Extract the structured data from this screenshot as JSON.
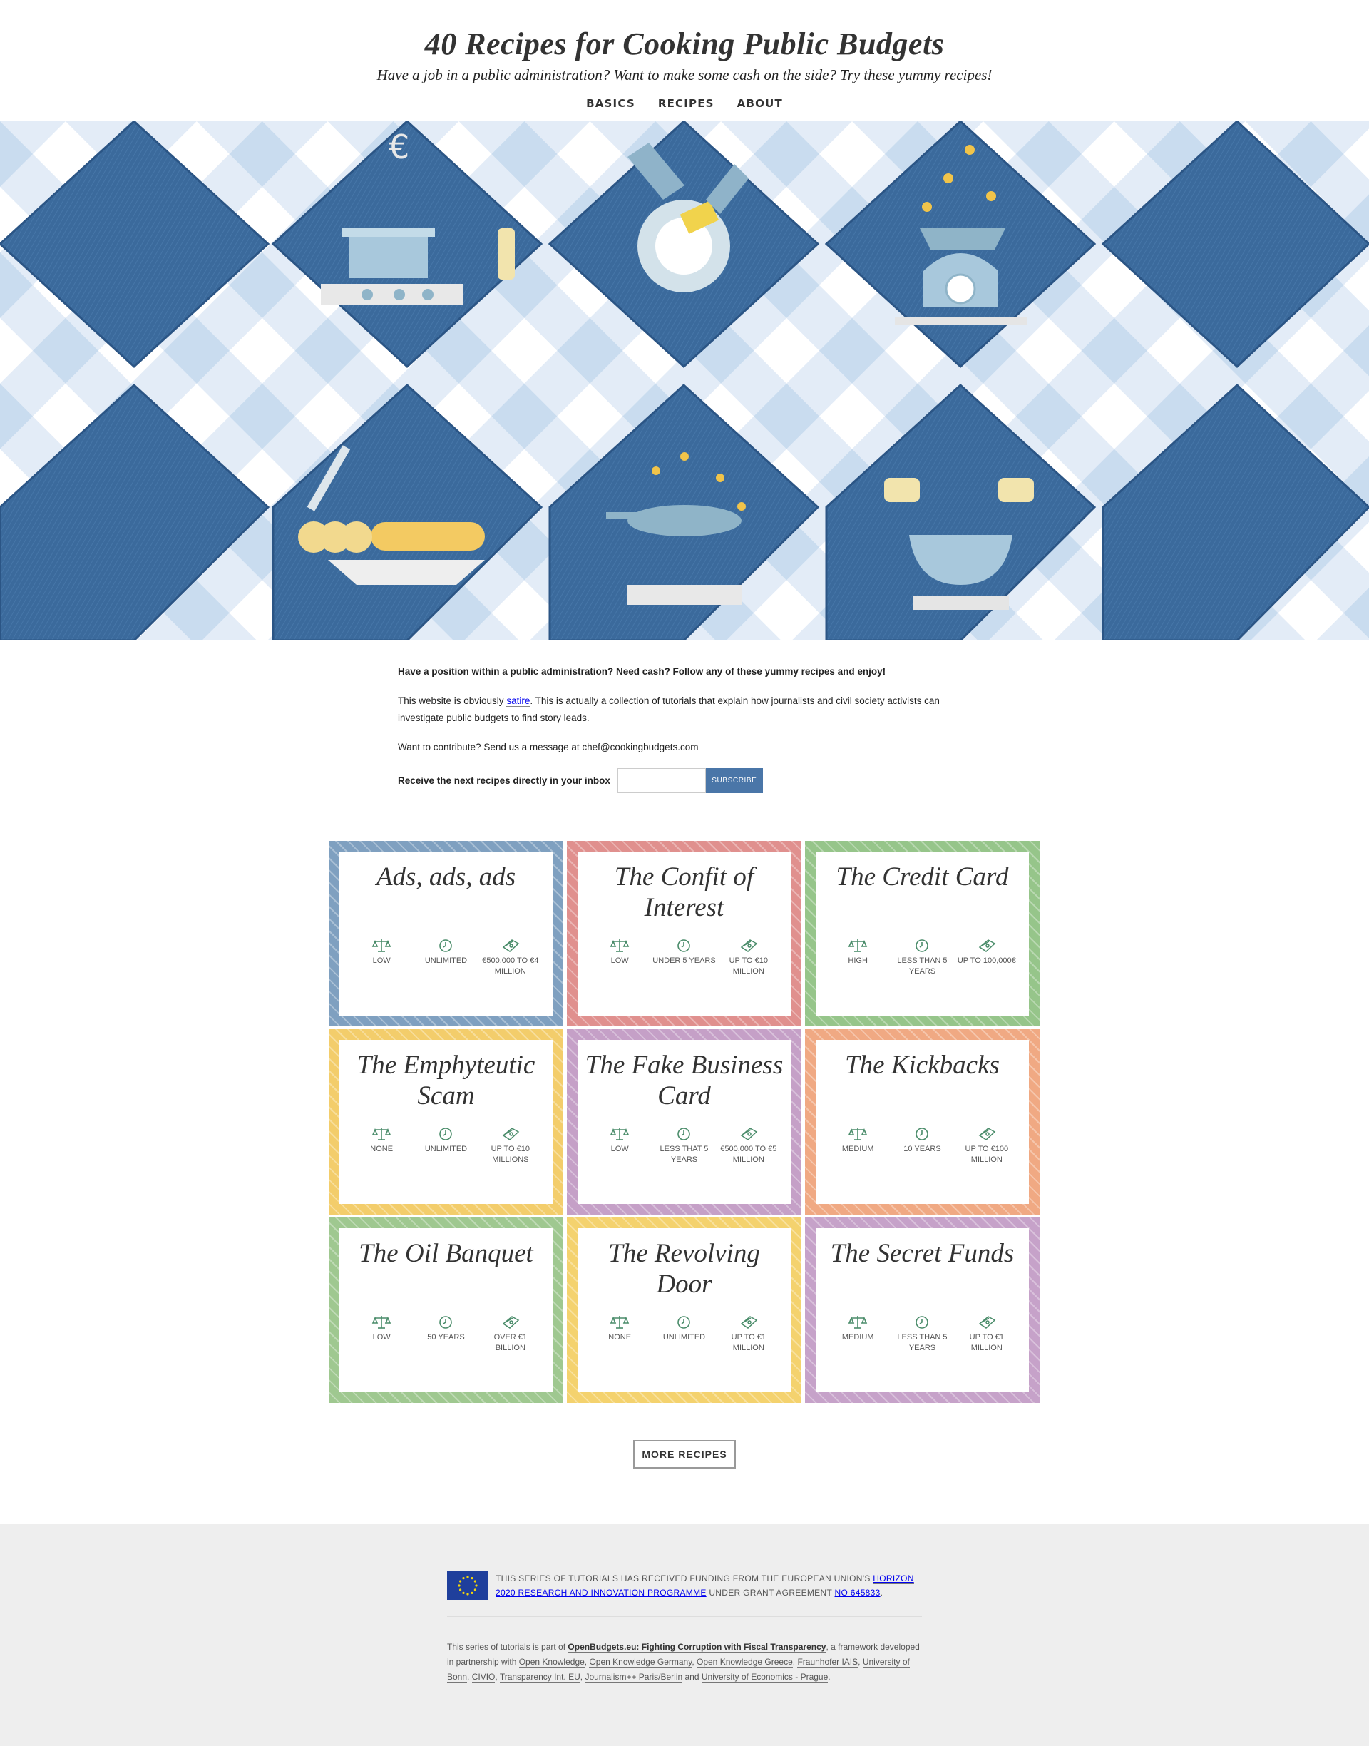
{
  "header": {
    "title": "40 Recipes for Cooking Public Budgets",
    "subtitle": "Have a job in a public administration? Want to make some cash on the side? Try these yummy recipes!",
    "nav": [
      "BASICS",
      "RECIPES",
      "ABOUT"
    ]
  },
  "colors": {
    "tile_blue": "#3b6a9c",
    "check_light": "#c9dcef",
    "accent_button": "#4a76a8"
  },
  "intro": {
    "lead": "Have a position within a public administration? Need cash? Follow any of these yummy recipes and enjoy!",
    "p2_before": "This website is obviously ",
    "p2_link": "satire",
    "p2_after": ". This is actually a collection of tutorials that explain how journalists and civil society activists can investigate public budgets to find story leads.",
    "p3": "Want to contribute? Send us a message at chef@cookingbudgets.com",
    "subscribe_label": "Receive the next recipes directly in your inbox",
    "subscribe_button": "SUBSCRIBE"
  },
  "cards": [
    {
      "title": "Ads, ads, ads",
      "color": "#7fa0c0",
      "risk": "LOW",
      "time": "UNLIMITED",
      "money": "€500,000 TO €4 MILLION"
    },
    {
      "title": "The Confit of Interest",
      "color": "#e0908e",
      "risk": "LOW",
      "time": "UNDER 5 YEARS",
      "money": "UP TO €10 MILLION"
    },
    {
      "title": "The Credit Card",
      "color": "#96c58a",
      "risk": "HIGH",
      "time": "LESS THAN 5 YEARS",
      "money": "UP TO 100,000€"
    },
    {
      "title": "The Emphyteutic Scam",
      "color": "#f3cd6b",
      "risk": "NONE",
      "time": "UNLIMITED",
      "money": "UP TO €10 MILLIONS"
    },
    {
      "title": "The Fake Business Card",
      "color": "#c5a0c7",
      "risk": "LOW",
      "time": "LESS THAT 5 YEARS",
      "money": "€500,000 TO €5 MILLION"
    },
    {
      "title": "The Kickbacks",
      "color": "#f0a983",
      "risk": "MEDIUM",
      "time": "10 YEARS",
      "money": "UP TO €100 MILLION"
    },
    {
      "title": "The Oil Banquet",
      "color": "#9fc890",
      "risk": "LOW",
      "time": "50 YEARS",
      "money": "OVER €1 BILLION"
    },
    {
      "title": "The Revolving Door",
      "color": "#f4d26e",
      "risk": "NONE",
      "time": "UNLIMITED",
      "money": "UP TO €1 MILLION"
    },
    {
      "title": "The Secret Funds",
      "color": "#c6a2c9",
      "risk": "MEDIUM",
      "time": "LESS THAN 5 YEARS",
      "money": "UP TO €1 MILLION"
    }
  ],
  "more_button": "MORE RECIPES",
  "footer": {
    "eu_before": "THIS SERIES OF TUTORIALS HAS RECEIVED FUNDING FROM THE EUROPEAN UNION'S ",
    "eu_link1": "HORIZON 2020 RESEARCH AND INNOVATION PROGRAMME",
    "eu_mid": " UNDER GRANT AGREEMENT ",
    "eu_link2": "NO 645833",
    "eu_end": ".",
    "credits_before": "This series of tutorials is part of ",
    "credits_bold": "OpenBudgets.eu: Fighting Corruption with Fiscal Transparency",
    "credits_mid": ", a framework developed in partnership with ",
    "partners": [
      "Open Knowledge",
      "Open Knowledge Germany",
      "Open Knowledge Greece",
      "Fraunhofer IAIS",
      "University of Bonn",
      "CIVIO",
      "Transparency Int. EU",
      "Journalism++ Paris/Berlin"
    ],
    "credits_and": " and ",
    "last_partner": "University of Economics - Prague",
    "credits_end": "."
  }
}
